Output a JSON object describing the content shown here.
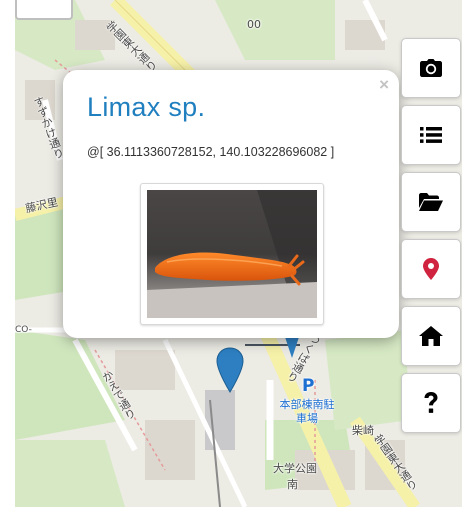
{
  "popup": {
    "title": "Limax sp.",
    "coordinates": "@[ 36.1113360728152, 140.103228696082 ]",
    "close_label": "×",
    "photo_icon": "slug-photo"
  },
  "toolbar": {
    "buttons": [
      {
        "icon": "camera-icon"
      },
      {
        "icon": "list-icon"
      },
      {
        "icon": "folder-open-icon"
      },
      {
        "icon": "map-marker-icon",
        "color": "#d0233f"
      },
      {
        "icon": "home-icon"
      },
      {
        "icon": "question-icon"
      }
    ]
  },
  "map": {
    "labels": {
      "top_road": "学園東大通り",
      "left_road": "すずかけ通り",
      "fujisawa": "藤沢里",
      "kaede": "かえで通り",
      "tsukuba": "つくば通り",
      "parking_p": "P",
      "parking_name": "本部棟南駐車場",
      "shibasaki": "柴崎",
      "univ_park": "大学公園",
      "minami": "南",
      "east_road": "学園東大通り",
      "park_sign": "00",
      "edge_text": "CO-"
    },
    "marker_color": "#2d7fc1",
    "colors": {
      "road_major": "#f6f1a8",
      "green": "#cfe6bd",
      "land": "#ecebe4",
      "building": "#ddd8cf"
    }
  }
}
